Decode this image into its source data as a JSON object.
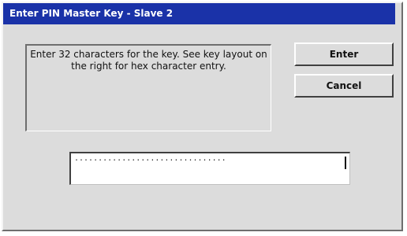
{
  "dialog": {
    "title": "Enter PIN Master Key - Slave 2",
    "message": "Enter 32 characters for the key. See key layout on the right for hex character entry.",
    "enter_label": "Enter",
    "cancel_label": "Cancel"
  },
  "key_input": {
    "value": "................................"
  }
}
